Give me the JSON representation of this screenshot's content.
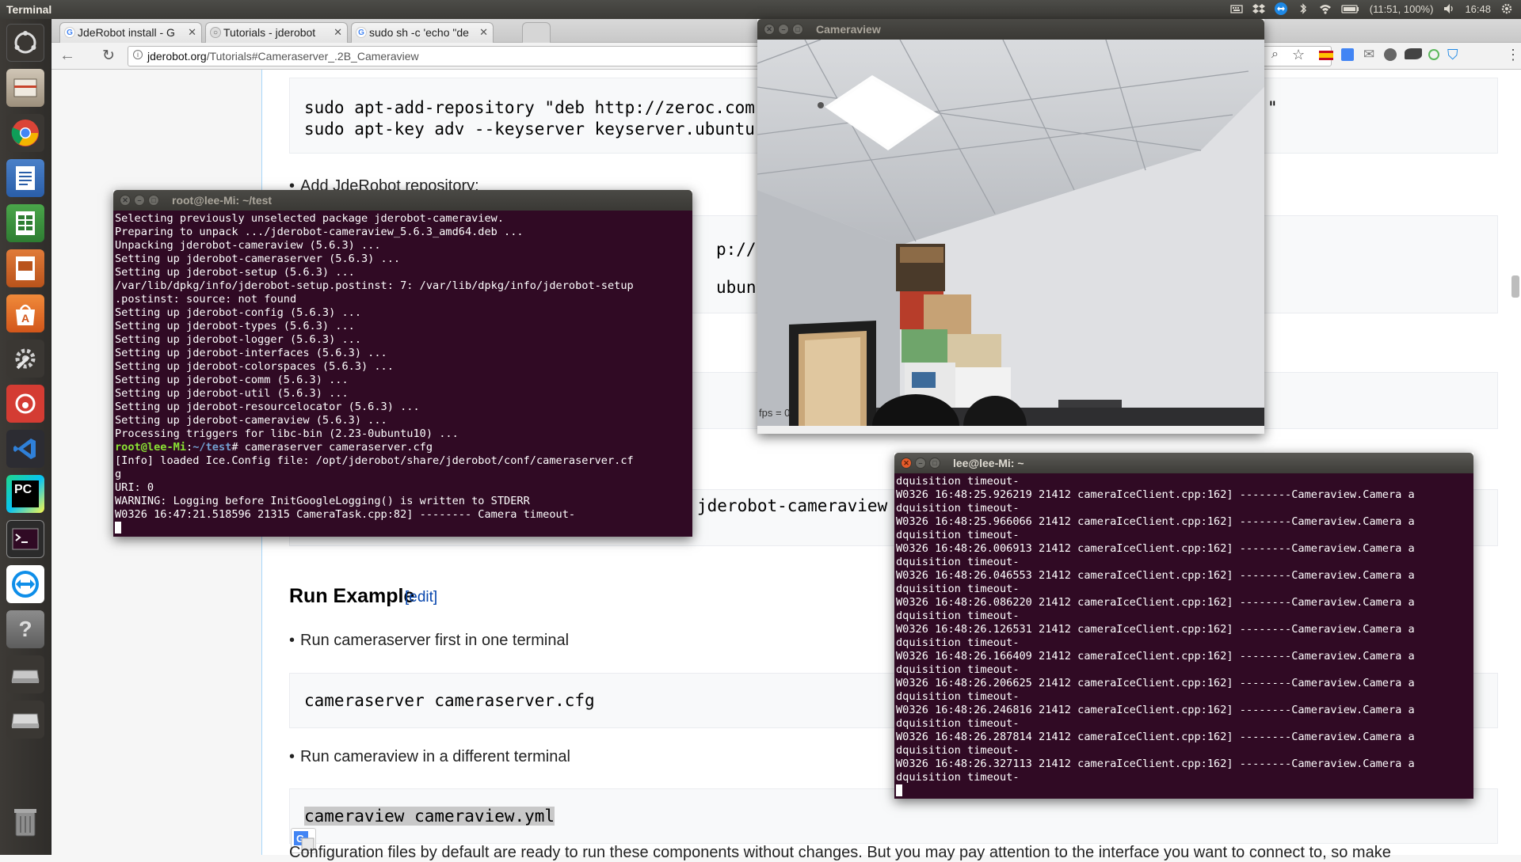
{
  "top_panel": {
    "app_name": "Terminal",
    "battery": "(11:51, 100%)",
    "clock": "16:48"
  },
  "launcher": {
    "items": [
      "Ubuntu Dash",
      "Files",
      "Chrome",
      "Writer",
      "Calc",
      "Impress",
      "Software Center",
      "System Settings",
      "NetEase Music",
      "VS Code",
      "PyCharm",
      "Terminal",
      "TeamViewer",
      "Help",
      "Drive",
      "Drive",
      "Trash"
    ]
  },
  "browser": {
    "tabs": [
      {
        "title": "JdeRobot install - G"
      },
      {
        "title": "Tutorials - jderobot"
      },
      {
        "title": "sudo sh -c 'echo \"de"
      }
    ],
    "url_host": "jderobot.org",
    "url_path": "/Tutorials#Cameraserver_.2B_Cameraview"
  },
  "page": {
    "code1_line1": "sudo apt-add-repository \"deb http://zeroc.com",
    "code1_line2": "sudo apt-key adv --keyserver keyserver.ubuntu",
    "code1_tail": "\"",
    "bullet_add_repo": "Add JdeRobot repository:",
    "code2_line1": "p://jde",
    "code2_line2": "ubuntu",
    "code_install_tail": "jderobot-cameraview",
    "run_example_heading": "Run Example",
    "run_example_edit": "edit",
    "bullet_run_server": "Run cameraserver first in one terminal",
    "code_server": "cameraserver cameraserver.cfg",
    "bullet_run_view": "Run cameraview in a different terminal",
    "code_view": "cameraview cameraview.yml",
    "config_text": "Configuration files by default are ready to run these components without changes. But you may pay attention to the interface you want to connect to, so make"
  },
  "terminal_root": {
    "title": "root@lee-Mi: ~/test",
    "lines": [
      "Selecting previously unselected package jderobot-cameraview.",
      "Preparing to unpack .../jderobot-cameraview_5.6.3_amd64.deb ...",
      "Unpacking jderobot-cameraview (5.6.3) ...",
      "Setting up jderobot-cameraserver (5.6.3) ...",
      "Setting up jderobot-setup (5.6.3) ...",
      "/var/lib/dpkg/info/jderobot-setup.postinst: 7: /var/lib/dpkg/info/jderobot-setup",
      ".postinst: source: not found",
      "Setting up jderobot-config (5.6.3) ...",
      "Setting up jderobot-types (5.6.3) ...",
      "Setting up jderobot-logger (5.6.3) ...",
      "Setting up jderobot-interfaces (5.6.3) ...",
      "Setting up jderobot-colorspaces (5.6.3) ...",
      "Setting up jderobot-comm (5.6.3) ...",
      "Setting up jderobot-util (5.6.3) ...",
      "Setting up jderobot-resourcelocator (5.6.3) ...",
      "Setting up jderobot-cameraview (5.6.3) ...",
      "Processing triggers for libc-bin (2.23-0ubuntu10) ..."
    ],
    "prompt_user": "root@lee-Mi",
    "prompt_sep": ":",
    "prompt_path": "~/test",
    "prompt_end": "# ",
    "command": "cameraserver cameraserver.cfg",
    "output": [
      "[Info] loaded Ice.Config file: /opt/jderobot/share/jderobot/conf/cameraserver.cf",
      "g",
      "URI: 0",
      "WARNING: Logging before InitGoogleLogging() is written to STDERR",
      "W0326 16:47:21.518596 21315 CameraTask.cpp:82] -------- Camera timeout-"
    ]
  },
  "cameraview": {
    "title": "Cameraview",
    "fps": "fps = 0"
  },
  "terminal_lee": {
    "title": "lee@lee-Mi: ~",
    "lines": [
      "dquisition timeout-",
      "W0326 16:48:25.926219 21412 cameraIceClient.cpp:162] --------Cameraview.Camera a",
      "dquisition timeout-",
      "W0326 16:48:25.966066 21412 cameraIceClient.cpp:162] --------Cameraview.Camera a",
      "dquisition timeout-",
      "W0326 16:48:26.006913 21412 cameraIceClient.cpp:162] --------Cameraview.Camera a",
      "dquisition timeout-",
      "W0326 16:48:26.046553 21412 cameraIceClient.cpp:162] --------Cameraview.Camera a",
      "dquisition timeout-",
      "W0326 16:48:26.086220 21412 cameraIceClient.cpp:162] --------Cameraview.Camera a",
      "dquisition timeout-",
      "W0326 16:48:26.126531 21412 cameraIceClient.cpp:162] --------Cameraview.Camera a",
      "dquisition timeout-",
      "W0326 16:48:26.166409 21412 cameraIceClient.cpp:162] --------Cameraview.Camera a",
      "dquisition timeout-",
      "W0326 16:48:26.206625 21412 cameraIceClient.cpp:162] --------Cameraview.Camera a",
      "dquisition timeout-",
      "W0326 16:48:26.246816 21412 cameraIceClient.cpp:162] --------Cameraview.Camera a",
      "dquisition timeout-",
      "W0326 16:48:26.287814 21412 cameraIceClient.cpp:162] --------Cameraview.Camera a",
      "dquisition timeout-",
      "W0326 16:48:26.327113 21412 cameraIceClient.cpp:162] --------Cameraview.Camera a",
      "dquisition timeout-"
    ]
  },
  "colors": {
    "terminal_bg": "#300a24",
    "link": "#0645ad",
    "close_button": "#e55b2a"
  }
}
